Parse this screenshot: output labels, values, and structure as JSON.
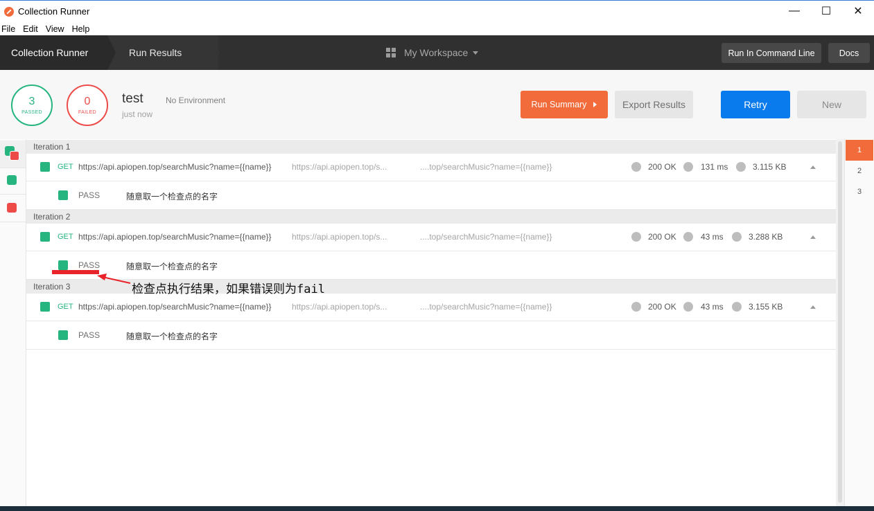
{
  "window": {
    "title": "Collection Runner",
    "minimize": "—",
    "maximize": "☐",
    "close": "✕"
  },
  "menu": [
    "File",
    "Edit",
    "View",
    "Help"
  ],
  "header": {
    "crumb_runner": "Collection Runner",
    "crumb_results": "Run Results",
    "workspace": "My Workspace",
    "cli_button": "Run In Command Line",
    "docs_button": "Docs"
  },
  "summary": {
    "passed_count": "3",
    "passed_label": "PASSED",
    "failed_count": "0",
    "failed_label": "FAILED",
    "name": "test",
    "environment": "No Environment",
    "time": "just now",
    "run_summary_button": "Run Summary",
    "export_button": "Export Results",
    "retry_button": "Retry",
    "new_button": "New"
  },
  "iterations": [
    {
      "label": "Iteration 1",
      "method": "GET",
      "url": "https://api.apiopen.top/searchMusic?name={{name}}",
      "url_resolved": "https://api.apiopen.top/s...",
      "url_tail": "....top/searchMusic?name={{name}}",
      "status": "200 OK",
      "time": "131 ms",
      "size": "3.115 KB",
      "test_result": "PASS",
      "test_name": "随意取一个检查点的名字"
    },
    {
      "label": "Iteration 2",
      "method": "GET",
      "url": "https://api.apiopen.top/searchMusic?name={{name}}",
      "url_resolved": "https://api.apiopen.top/s...",
      "url_tail": "....top/searchMusic?name={{name}}",
      "status": "200 OK",
      "time": "43 ms",
      "size": "3.288 KB",
      "test_result": "PASS",
      "test_name": "随意取一个检查点的名字"
    },
    {
      "label": "Iteration 3",
      "method": "GET",
      "url": "https://api.apiopen.top/searchMusic?name={{name}}",
      "url_resolved": "https://api.apiopen.top/s...",
      "url_tail": "....top/searchMusic?name={{name}}",
      "status": "200 OK",
      "time": "43 ms",
      "size": "3.155 KB",
      "test_result": "PASS",
      "test_name": "随意取一个检查点的名字"
    }
  ],
  "annotation": "检查点执行结果，如果错误则为fail",
  "pages": [
    "1",
    "2",
    "3"
  ],
  "colors": {
    "accent": "#f26b3a",
    "pass": "#26b47f",
    "fail": "#ed4b48",
    "primary": "#097bed"
  }
}
